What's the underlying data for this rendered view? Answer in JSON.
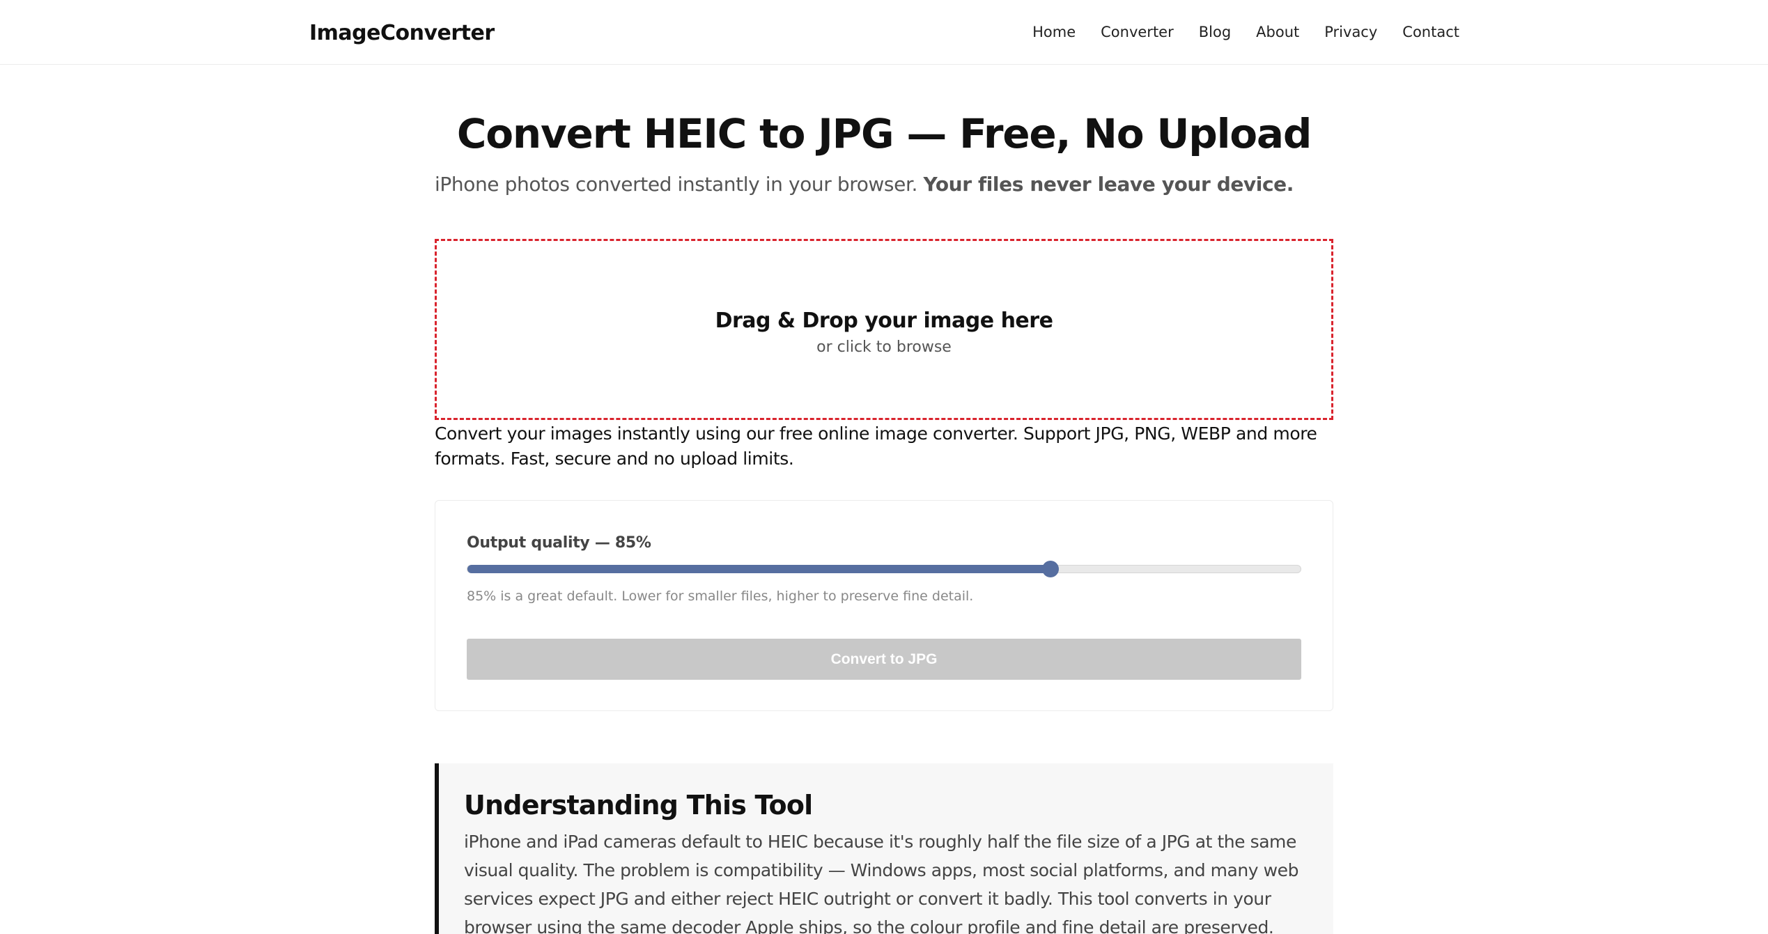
{
  "nav": {
    "brand": "ImageConverter",
    "links": [
      "Home",
      "Converter",
      "Blog",
      "About",
      "Privacy",
      "Contact"
    ]
  },
  "hero": {
    "title": "Convert HEIC to JPG — Free, No Upload",
    "subtitle_plain": "iPhone photos converted instantly in your browser.",
    "subtitle_bold": "Your files never leave your device."
  },
  "dropzone": {
    "title": "Drag & Drop your image here",
    "subtitle": "or click to browse"
  },
  "intro": "Convert your images instantly using our free online image converter. Support JPG, PNG, WEBP and more formats. Fast, secure and no upload limits.",
  "options": {
    "quality_label": "Output quality — 85%",
    "quality_value": 0.7,
    "help_text": "85% is a great default. Lower for smaller files, higher to preserve fine detail.",
    "convert_button": "Convert to JPG"
  },
  "explainer": {
    "title": "Understanding This Tool",
    "body": "iPhone and iPad cameras default to HEIC because it's roughly half the file size of a JPG at the same visual quality. The problem is compatibility — Windows apps, most social platforms, and many web services expect JPG and either reject HEIC outright or convert it badly. This tool converts in your browser using the same decoder Apple ships, so the colour profile and fine detail are preserved. Nothing is uploaded; the file never"
  },
  "colors": {
    "accent": "#566ea0",
    "dropzone_border": "#d9232d",
    "disabled_button": "#c8c8c8"
  }
}
